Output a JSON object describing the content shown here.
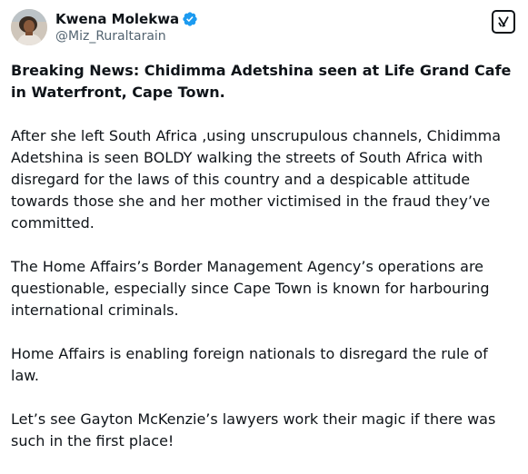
{
  "author": {
    "display_name": "Kwena Molekwa",
    "handle": "@Miz_Ruraltarain",
    "verified": true,
    "verified_color": "#1d9bf0"
  },
  "toolbar": {
    "grok_icon": "grok-icon"
  },
  "post": {
    "headline": "Breaking News: Chidimma Adetshina seen at Life Grand Cafe in Waterfront, Cape Town.",
    "paragraphs": [
      "After she left South Africa ,using unscrupulous channels, Chidimma Adetshina is seen BOLDY walking the streets of South Africa with disregard for the laws of this country and a despicable attitude towards those she and her mother victimised in the fraud they’ve committed.",
      "The Home Affairs’s Border Management Agency’s operations are questionable, especially since Cape Town is known for harbouring international criminals.",
      "Home Affairs is enabling foreign nationals to disregard the rule of law.",
      "Let’s see Gayton McKenzie’s lawyers work their magic if there was such in the first place!"
    ]
  }
}
